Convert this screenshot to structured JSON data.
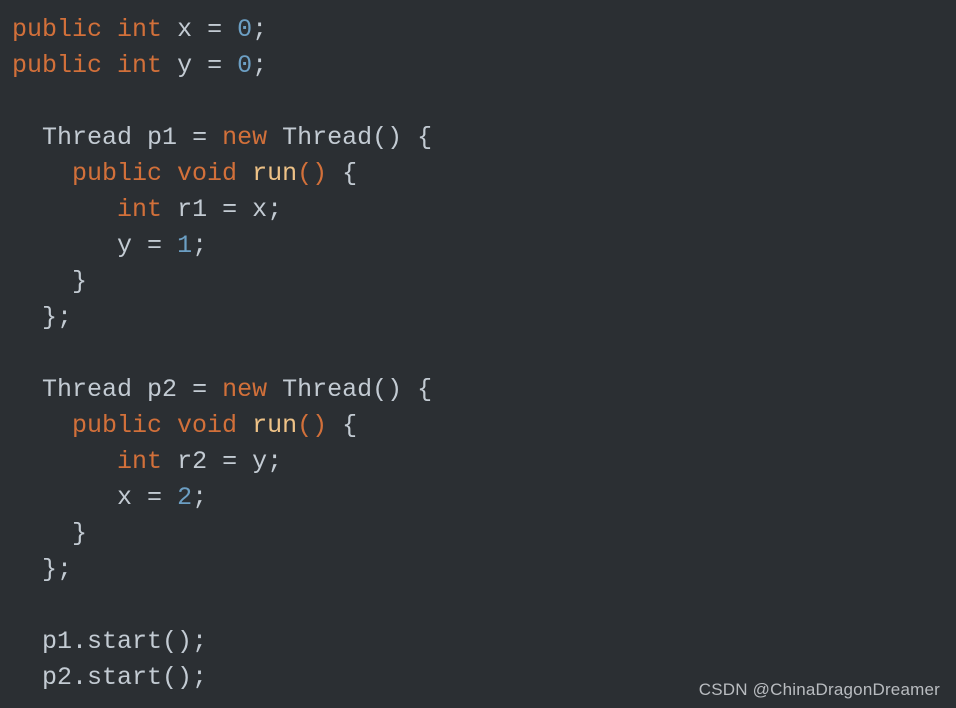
{
  "theme": {
    "background": "#2b2f33",
    "foreground": "#c3cbd3",
    "keyword_color": "#d2703a",
    "number_color": "#6c9fc4",
    "method_color": "#eec287",
    "punctuation_color": "#c3cbd3",
    "watermark_color": "#b9bcc0"
  },
  "code": {
    "language": "java",
    "lines": [
      {
        "id": 1,
        "indent": 0,
        "tokens": [
          {
            "t": "public",
            "k": "keyword"
          },
          {
            "t": " ",
            "k": "plain"
          },
          {
            "t": "int",
            "k": "keyword"
          },
          {
            "t": " ",
            "k": "plain"
          },
          {
            "t": "x",
            "k": "plain"
          },
          {
            "t": " = ",
            "k": "plain"
          },
          {
            "t": "0",
            "k": "number"
          },
          {
            "t": ";",
            "k": "punct"
          }
        ]
      },
      {
        "id": 2,
        "indent": 0,
        "tokens": [
          {
            "t": "public",
            "k": "keyword"
          },
          {
            "t": " ",
            "k": "plain"
          },
          {
            "t": "int",
            "k": "keyword"
          },
          {
            "t": " ",
            "k": "plain"
          },
          {
            "t": "y",
            "k": "plain"
          },
          {
            "t": " = ",
            "k": "plain"
          },
          {
            "t": "0",
            "k": "number"
          },
          {
            "t": ";",
            "k": "punct"
          }
        ]
      },
      {
        "id": 3,
        "indent": 0,
        "tokens": []
      },
      {
        "id": 4,
        "indent": 2,
        "tokens": [
          {
            "t": "Thread",
            "k": "plain"
          },
          {
            "t": " ",
            "k": "plain"
          },
          {
            "t": "p1",
            "k": "plain"
          },
          {
            "t": " = ",
            "k": "plain"
          },
          {
            "t": "new",
            "k": "keyword"
          },
          {
            "t": " ",
            "k": "plain"
          },
          {
            "t": "Thread()",
            "k": "plain"
          },
          {
            "t": " ",
            "k": "plain"
          },
          {
            "t": "{",
            "k": "punct"
          }
        ]
      },
      {
        "id": 5,
        "indent": 4,
        "tokens": [
          {
            "t": "public",
            "k": "keyword"
          },
          {
            "t": " ",
            "k": "plain"
          },
          {
            "t": "void",
            "k": "keyword"
          },
          {
            "t": " ",
            "k": "plain"
          },
          {
            "t": "run",
            "k": "method"
          },
          {
            "t": "()",
            "k": "paren"
          },
          {
            "t": " ",
            "k": "plain"
          },
          {
            "t": "{",
            "k": "punct"
          }
        ]
      },
      {
        "id": 6,
        "indent": 7,
        "tokens": [
          {
            "t": "int",
            "k": "keyword"
          },
          {
            "t": " ",
            "k": "plain"
          },
          {
            "t": "r1",
            "k": "plain"
          },
          {
            "t": " = ",
            "k": "plain"
          },
          {
            "t": "x",
            "k": "plain"
          },
          {
            "t": ";",
            "k": "punct"
          }
        ]
      },
      {
        "id": 7,
        "indent": 7,
        "tokens": [
          {
            "t": "y",
            "k": "plain"
          },
          {
            "t": " = ",
            "k": "plain"
          },
          {
            "t": "1",
            "k": "number"
          },
          {
            "t": ";",
            "k": "punct"
          }
        ]
      },
      {
        "id": 8,
        "indent": 4,
        "tokens": [
          {
            "t": "}",
            "k": "punct"
          }
        ]
      },
      {
        "id": 9,
        "indent": 2,
        "tokens": [
          {
            "t": "};",
            "k": "punct"
          }
        ]
      },
      {
        "id": 10,
        "indent": 0,
        "tokens": []
      },
      {
        "id": 11,
        "indent": 2,
        "tokens": [
          {
            "t": "Thread",
            "k": "plain"
          },
          {
            "t": " ",
            "k": "plain"
          },
          {
            "t": "p2",
            "k": "plain"
          },
          {
            "t": " = ",
            "k": "plain"
          },
          {
            "t": "new",
            "k": "keyword"
          },
          {
            "t": " ",
            "k": "plain"
          },
          {
            "t": "Thread()",
            "k": "plain"
          },
          {
            "t": " ",
            "k": "plain"
          },
          {
            "t": "{",
            "k": "punct"
          }
        ]
      },
      {
        "id": 12,
        "indent": 4,
        "tokens": [
          {
            "t": "public",
            "k": "keyword"
          },
          {
            "t": " ",
            "k": "plain"
          },
          {
            "t": "void",
            "k": "keyword"
          },
          {
            "t": " ",
            "k": "plain"
          },
          {
            "t": "run",
            "k": "method"
          },
          {
            "t": "()",
            "k": "paren"
          },
          {
            "t": " ",
            "k": "plain"
          },
          {
            "t": "{",
            "k": "punct"
          }
        ]
      },
      {
        "id": 13,
        "indent": 7,
        "tokens": [
          {
            "t": "int",
            "k": "keyword"
          },
          {
            "t": " ",
            "k": "plain"
          },
          {
            "t": "r2",
            "k": "plain"
          },
          {
            "t": " = ",
            "k": "plain"
          },
          {
            "t": "y",
            "k": "plain"
          },
          {
            "t": ";",
            "k": "punct"
          }
        ]
      },
      {
        "id": 14,
        "indent": 7,
        "tokens": [
          {
            "t": "x",
            "k": "plain"
          },
          {
            "t": " = ",
            "k": "plain"
          },
          {
            "t": "2",
            "k": "number"
          },
          {
            "t": ";",
            "k": "punct"
          }
        ]
      },
      {
        "id": 15,
        "indent": 4,
        "tokens": [
          {
            "t": "}",
            "k": "punct"
          }
        ]
      },
      {
        "id": 16,
        "indent": 2,
        "tokens": [
          {
            "t": "};",
            "k": "punct"
          }
        ]
      },
      {
        "id": 17,
        "indent": 0,
        "tokens": []
      },
      {
        "id": 18,
        "indent": 2,
        "tokens": [
          {
            "t": "p1.start();",
            "k": "plain"
          }
        ]
      },
      {
        "id": 19,
        "indent": 2,
        "tokens": [
          {
            "t": "p2.start();",
            "k": "plain"
          }
        ]
      }
    ],
    "plain_text": "public int x = 0;\npublic int y = 0;\n\n  Thread p1 = new Thread() {\n    public void run() {\n       int r1 = x;\n       y = 1;\n    }\n  };\n\n  Thread p2 = new Thread() {\n    public void run() {\n       int r2 = y;\n       x = 2;\n    }\n  };\n\n  p1.start();\n  p2.start();"
  },
  "watermark": {
    "text": "CSDN @ChinaDragonDreamer"
  }
}
